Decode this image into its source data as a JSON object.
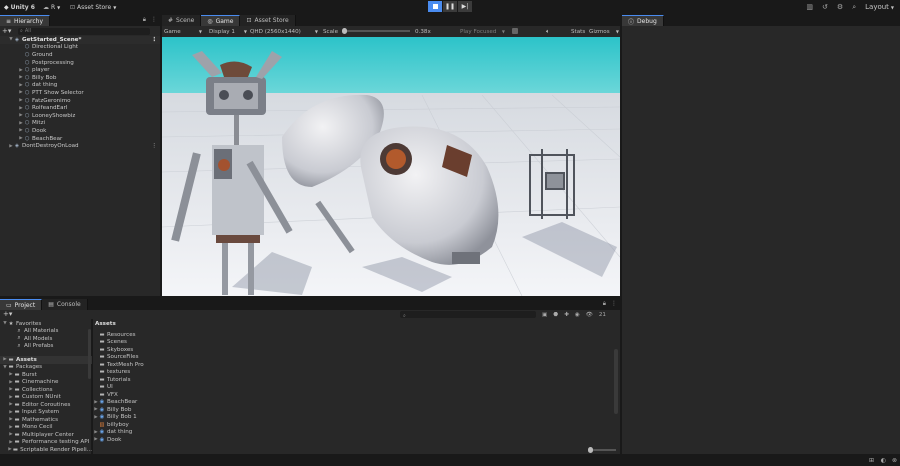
{
  "toolbar": {
    "unity_label": "Unity 6",
    "account_label": "R",
    "asset_store_label": "Asset Store",
    "layout_label": "Layout"
  },
  "hierarchy": {
    "tab_label": "Hierarchy",
    "search_placeholder": "All",
    "scene_name": "GetStarted_Scene*",
    "items": [
      {
        "label": "Directional Light",
        "icon": "gameobject-icon"
      },
      {
        "label": "Ground",
        "icon": "gameobject-icon"
      },
      {
        "label": "Postprocessing",
        "icon": "gameobject-icon"
      },
      {
        "label": "player",
        "icon": "gameobject-icon"
      },
      {
        "label": "Billy Bob",
        "icon": "gameobject-icon"
      },
      {
        "label": "dat thing",
        "icon": "gameobject-icon"
      },
      {
        "label": "PTT Show Selector",
        "icon": "gameobject-icon"
      },
      {
        "label": "FatzGeronimo",
        "icon": "gameobject-icon"
      },
      {
        "label": "RolfeandEarl",
        "icon": "gameobject-icon"
      },
      {
        "label": "LooneyShowbiz",
        "icon": "gameobject-icon"
      },
      {
        "label": "Mitzi",
        "icon": "gameobject-icon"
      },
      {
        "label": "Dook",
        "icon": "gameobject-icon"
      },
      {
        "label": "BeachBear",
        "icon": "gameobject-icon"
      }
    ],
    "dont_destroy": "DontDestroyOnLoad"
  },
  "center_tabs": [
    "Scene",
    "Game",
    "Asset Store"
  ],
  "game_bar": {
    "display_mode": "Game",
    "display": "Display 1",
    "resolution": "QHD (2560x1440)",
    "scale_label": "Scale",
    "scale_value": "0.38x",
    "play_focused": "Play Focused",
    "stats": "Stats",
    "gizmos": "Gizmos"
  },
  "debug": {
    "tab_label": "Debug"
  },
  "bottom_tabs": [
    "Project",
    "Console"
  ],
  "project": {
    "hidden_count": "21",
    "favorites_label": "Favorites",
    "favorites": [
      "All Materials",
      "All Models",
      "All Prefabs"
    ],
    "assets_label": "Assets",
    "packages_label": "Packages",
    "packages": [
      "Burst",
      "Cinemachine",
      "Collections",
      "Custom NUnit",
      "Editor Coroutines",
      "Input System",
      "Mathematics",
      "Mono Cecil",
      "Multiplayer Center",
      "Performance testing API",
      "Scriptable Render Pipeli..."
    ],
    "breadcrumb": "Assets",
    "asset_items": [
      {
        "label": "Resources",
        "type": "folder"
      },
      {
        "label": "Scenes",
        "type": "folder"
      },
      {
        "label": "Skyboxes",
        "type": "folder"
      },
      {
        "label": "SourceFiles",
        "type": "folder"
      },
      {
        "label": "TextMesh Pro",
        "type": "folder"
      },
      {
        "label": "textures",
        "type": "folder"
      },
      {
        "label": "Tutorials",
        "type": "folder"
      },
      {
        "label": "UI",
        "type": "folder"
      },
      {
        "label": "VFX",
        "type": "folder"
      },
      {
        "label": "BeachBear",
        "type": "prefab"
      },
      {
        "label": "Billy Bob",
        "type": "prefab"
      },
      {
        "label": "Billy Bob 1",
        "type": "prefab"
      },
      {
        "label": "billyboy",
        "type": "image"
      },
      {
        "label": "dat thing",
        "type": "prefab"
      },
      {
        "label": "Dook",
        "type": "prefab"
      }
    ]
  },
  "colors": {
    "accent": "#4a8cf0",
    "panel": "#282828",
    "chrome": "#191919",
    "sky": "#38c7d0"
  }
}
